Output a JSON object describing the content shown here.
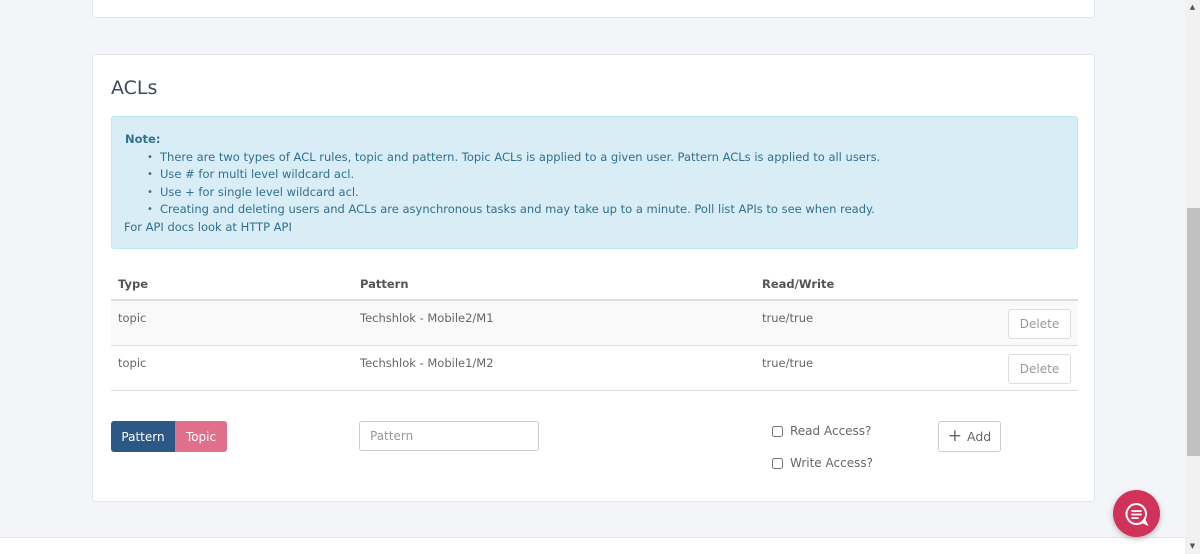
{
  "acls": {
    "title": "ACLs",
    "note": {
      "heading": "Note:",
      "items": [
        "There are two types of ACL rules, topic and pattern. Topic ACLs is applied to a given user. Pattern ACLs is applied to all users.",
        "Use # for multi level wildcard acl.",
        "Use + for single level wildcard acl.",
        "Creating and deleting users and ACLs are asynchronous tasks and may take up to a minute. Poll list APIs to see when ready."
      ],
      "footer": "For API docs look at HTTP API"
    },
    "table": {
      "columns": [
        "Type",
        "Pattern",
        "Read/Write"
      ],
      "rows": [
        {
          "type": "topic",
          "pattern": "Techshlok - Mobile2/M1",
          "rw": "true/true",
          "action": "Delete"
        },
        {
          "type": "topic",
          "pattern": "Techshlok - Mobile1/M2",
          "rw": "true/true",
          "action": "Delete"
        }
      ]
    },
    "form": {
      "toggle": {
        "pattern_label": "Pattern",
        "topic_label": "Topic",
        "selected": "Pattern"
      },
      "pattern_placeholder": "Pattern",
      "pattern_value": "",
      "read_access_label": "Read Access?",
      "write_access_label": "Write Access?",
      "read_access_checked": false,
      "write_access_checked": false,
      "add_label": "Add"
    }
  },
  "colors": {
    "primary": "#2b5885",
    "topic": "#e06f8b",
    "chat": "#d0325a",
    "info_bg": "#d9edf7",
    "info_text": "#31708f"
  },
  "icons": {
    "chat": "chat-bubble-icon",
    "add": "plus-icon",
    "scroll_up": "arrow-up-icon",
    "scroll_down": "arrow-down-icon"
  }
}
